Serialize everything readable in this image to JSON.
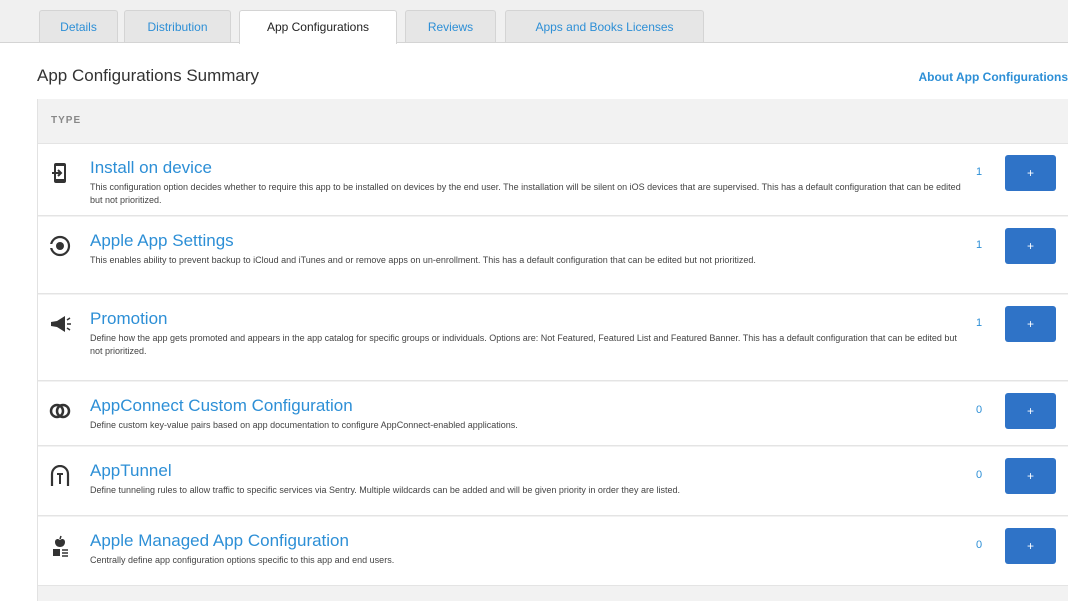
{
  "tabs": [
    {
      "label": "Details"
    },
    {
      "label": "Distribution"
    },
    {
      "label": "App Configurations"
    },
    {
      "label": "Reviews"
    },
    {
      "label": "Apps and Books Licenses"
    }
  ],
  "active_tab": "App Configurations",
  "page_title": "App Configurations Summary",
  "about_link": "About App Configurations",
  "table": {
    "header_type": "TYPE",
    "rows": [
      {
        "name": "Install on device",
        "description": "This configuration option decides whether to require this app to be installed on devices by the end user. The installation will be silent on iOS devices that are supervised. This has a default configuration that can be edited but not prioritized.",
        "count": "1",
        "add_label": "+",
        "icon": "install-device-icon"
      },
      {
        "name": "Apple App Settings",
        "description": "This enables ability to prevent backup to iCloud and iTunes and or remove apps on un-enrollment. This has a default configuration that can be edited but not prioritized.",
        "count": "1",
        "add_label": "+",
        "icon": "app-settings-icon"
      },
      {
        "name": "Promotion",
        "description": "Define how the app gets promoted and appears in the app catalog for specific groups or individuals. Options are: Not Featured, Featured List and Featured Banner. This has a default configuration that can be edited but not prioritized.",
        "count": "1",
        "add_label": "+",
        "icon": "megaphone-icon"
      },
      {
        "name": "AppConnect Custom Configuration",
        "description": "Define custom key-value pairs based on app documentation to configure AppConnect-enabled applications.",
        "count": "0",
        "add_label": "+",
        "icon": "appconnect-icon"
      },
      {
        "name": "AppTunnel",
        "description": "Define tunneling rules to allow traffic to specific services via Sentry. Multiple wildcards can be added and will be given priority in order they are listed.",
        "count": "0",
        "add_label": "+",
        "icon": "apptunnel-icon"
      },
      {
        "name": "Apple Managed App Configuration",
        "description": "Centrally define app configuration options specific to this app and end users.",
        "count": "0",
        "add_label": "+",
        "icon": "apple-managed-config-icon"
      }
    ]
  },
  "colors": {
    "link": "#2d8fd6",
    "button": "#2f73c7",
    "background_gray": "#f2f2f2"
  }
}
